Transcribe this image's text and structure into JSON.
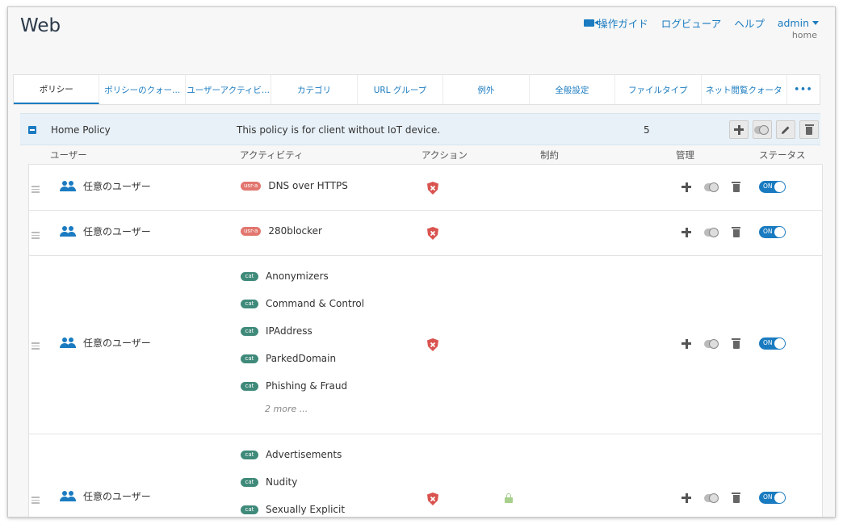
{
  "header": {
    "title": "Web",
    "links": {
      "guide": "操作ガイド",
      "log_viewer": "ログビューア",
      "help": "ヘルプ",
      "user": "admin",
      "subtitle": "home"
    }
  },
  "tabs": [
    "ポリシー",
    "ポリシーのクォー...",
    "ユーザーアクティビ...",
    "カテゴリ",
    "URL グループ",
    "例外",
    "全般設定",
    "ファイルタイプ",
    "ネット閲覧クォータ",
    "•••"
  ],
  "policy": {
    "name": "Home Policy",
    "description": "This policy is for client without IoT device.",
    "count": "5"
  },
  "columns": {
    "user": "ユーザー",
    "activity": "アクティビティ",
    "action": "アクション",
    "restriction": "制約",
    "manage": "管理",
    "status": "ステータス"
  },
  "rows": [
    {
      "user": "任意のユーザー",
      "activities": [
        {
          "badge": "usr-a",
          "label": "DNS over HTTPS"
        }
      ],
      "status": "ON"
    },
    {
      "user": "任意のユーザー",
      "activities": [
        {
          "badge": "usr-a",
          "label": "280blocker"
        }
      ],
      "status": "ON"
    },
    {
      "user": "任意のユーザー",
      "activities": [
        {
          "badge": "cat",
          "label": "Anonymizers"
        },
        {
          "badge": "cat",
          "label": "Command & Control"
        },
        {
          "badge": "cat",
          "label": "IPAddress"
        },
        {
          "badge": "cat",
          "label": "ParkedDomain"
        },
        {
          "badge": "cat",
          "label": "Phishing & Fraud"
        }
      ],
      "more": "2 more ...",
      "status": "ON"
    },
    {
      "user": "任意のユーザー",
      "activities": [
        {
          "badge": "cat",
          "label": "Advertisements"
        },
        {
          "badge": "cat",
          "label": "Nudity"
        },
        {
          "badge": "cat",
          "label": "Sexually Explicit"
        }
      ],
      "status": "ON"
    }
  ],
  "colors": {
    "accent": "#1a7bc0",
    "block": "#d9534f",
    "lock": "#a8d08d"
  },
  "icons": [
    "video-camera-icon",
    "caret-down-icon",
    "collapse-icon",
    "plus-icon",
    "duplicate-icon",
    "edit-icon",
    "trash-icon",
    "users-icon",
    "block-shield-icon",
    "lock-icon",
    "drag-handle-icon"
  ]
}
